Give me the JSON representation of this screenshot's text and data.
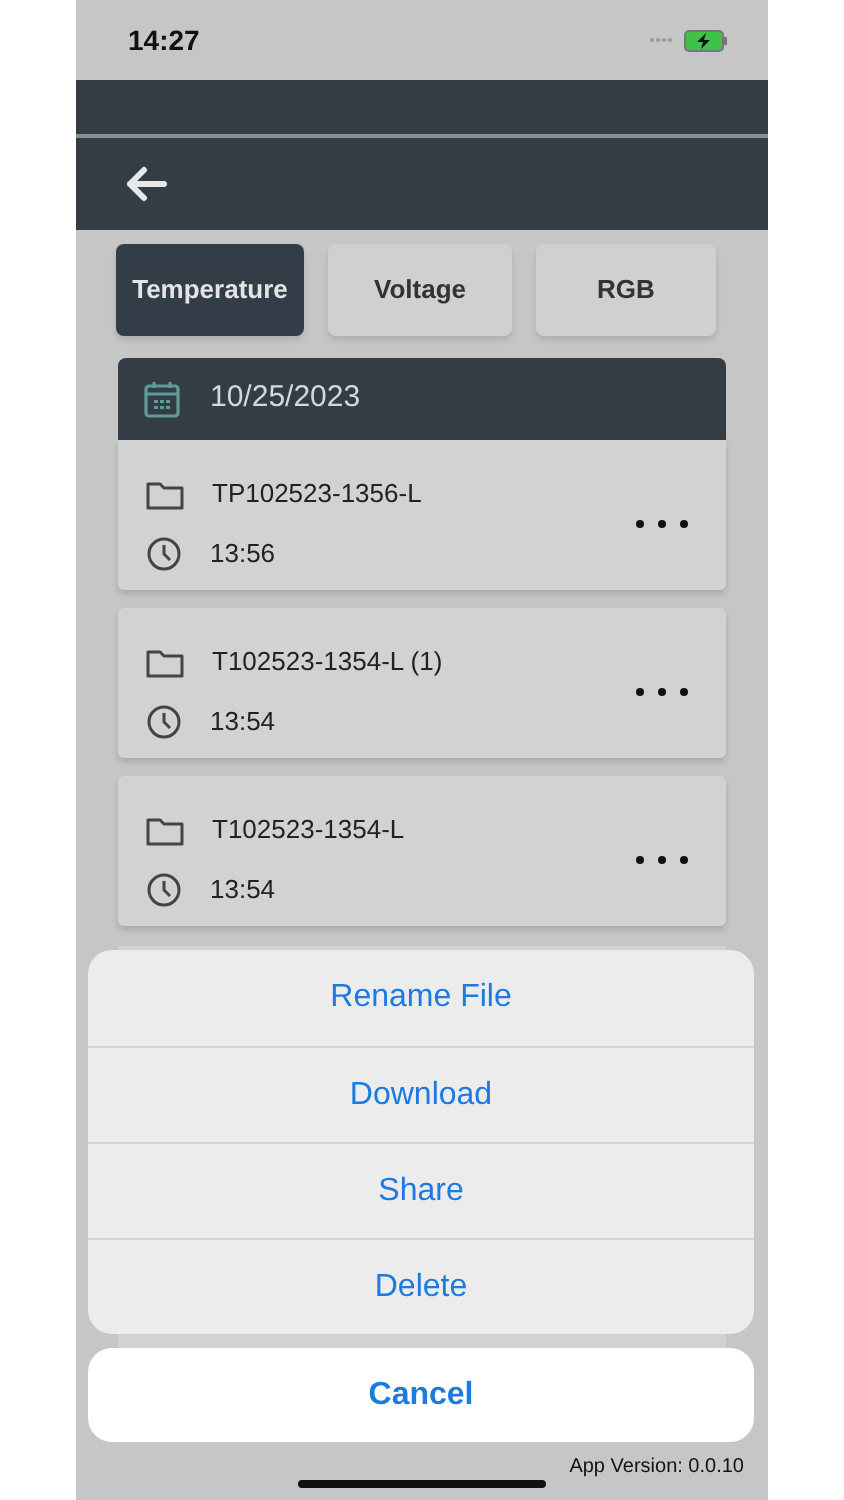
{
  "status_bar": {
    "time": "14:27",
    "battery_charging": true
  },
  "header": {
    "back": true
  },
  "tabs": [
    {
      "label": "Temperature",
      "selected": true
    },
    {
      "label": "Voltage",
      "selected": false
    },
    {
      "label": "RGB",
      "selected": false
    }
  ],
  "date_header": "10/25/2023",
  "files": [
    {
      "name": "TP102523-1356-L",
      "time": "13:56"
    },
    {
      "name": "T102523-1354-L (1)",
      "time": "13:54"
    },
    {
      "name": "T102523-1354-L",
      "time": "13:54"
    }
  ],
  "action_sheet": {
    "actions": [
      "Rename File",
      "Download",
      "Share",
      "Delete"
    ],
    "cancel": "Cancel"
  },
  "footer": {
    "app_version": "App Version: 0.0.10"
  }
}
